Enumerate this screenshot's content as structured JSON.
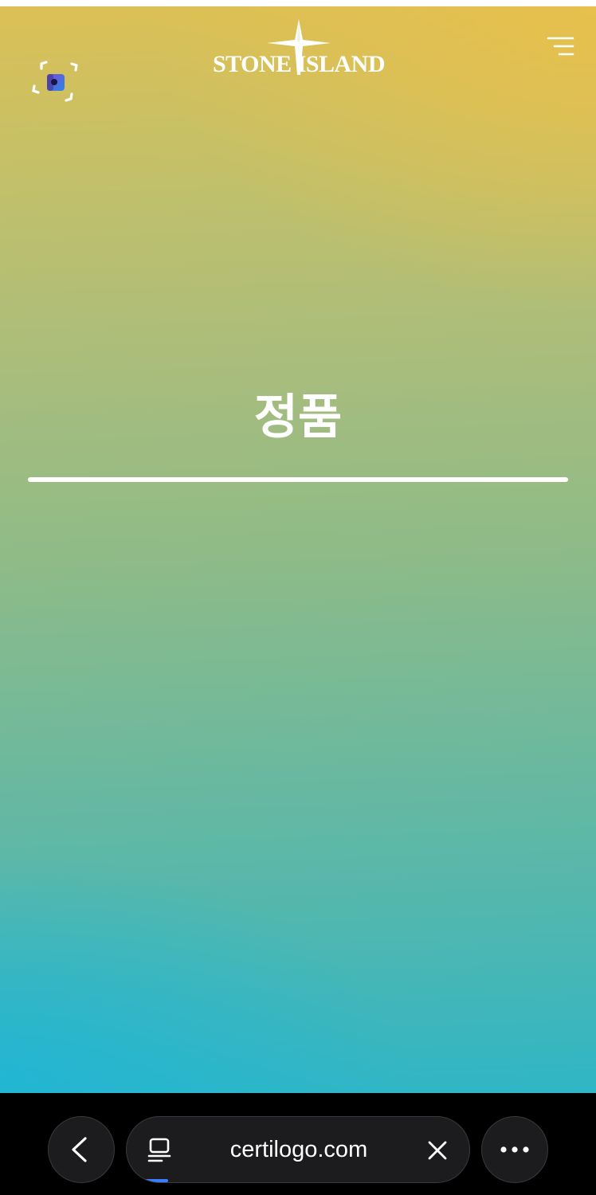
{
  "header": {
    "brand_name": "STONE ISLAND",
    "scan_icon": "scan-frame-icon",
    "menu_icon": "hamburger-menu-icon"
  },
  "status": {
    "label": "정품"
  },
  "browser_toolbar": {
    "back_icon": "chevron-left-icon",
    "tabs_icon": "tabs-icon",
    "url": "certilogo.com",
    "clear_icon": "close-icon",
    "more_icon": "ellipsis-icon"
  },
  "colors": {
    "gradient_top": "#e6be50",
    "gradient_middle": "#8fbb87",
    "gradient_bottom": "#22b6d2",
    "text": "#ffffff",
    "toolbar_background": "#000000",
    "toolbar_pill": "#1c1c1e",
    "loading_indicator": "#3d7cff"
  }
}
